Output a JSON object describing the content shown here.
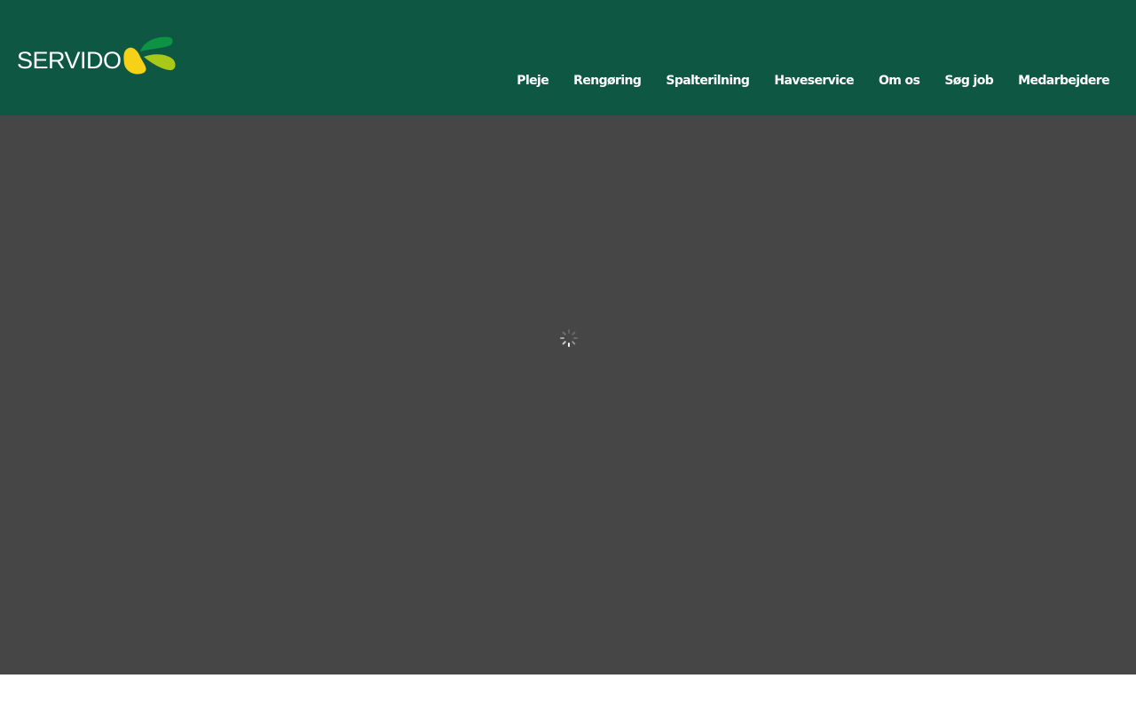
{
  "brand": {
    "name": "SERVIDO",
    "logo_colors": [
      "#0c9444",
      "#a8c81a",
      "#f7d117"
    ]
  },
  "nav": {
    "items": [
      {
        "label": "Pleje"
      },
      {
        "label": "Rengøring"
      },
      {
        "label": "Spalterilning"
      },
      {
        "label": "Haveservice"
      },
      {
        "label": "Om os"
      },
      {
        "label": "Søg job"
      },
      {
        "label": "Medarbejdere"
      }
    ]
  },
  "colors": {
    "header_bg": "#0e5843",
    "hero_bg": "#464646",
    "page_bg": "#ffffff"
  },
  "hero": {
    "state": "loading",
    "icon": "loading-spinner-icon"
  }
}
